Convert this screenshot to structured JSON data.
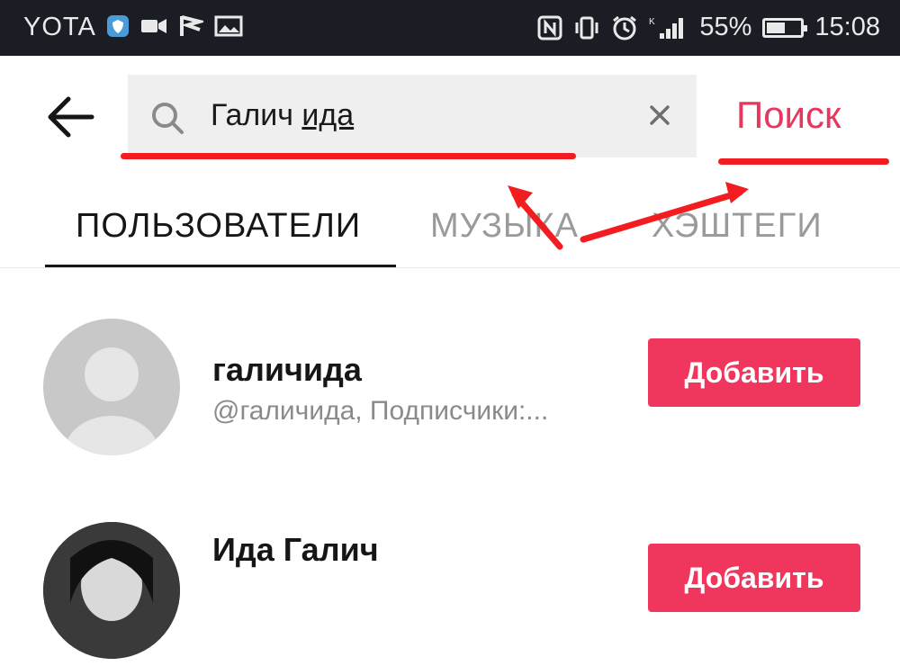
{
  "status_bar": {
    "carrier": "YOTA",
    "battery": "55%",
    "battery_level": 0.55,
    "time": "15:08"
  },
  "search": {
    "query_part1": "Галич ",
    "query_part2": "ида",
    "submit_label": "Поиск"
  },
  "tabs": [
    {
      "label": "ПОЛЬЗОВАТЕЛИ"
    },
    {
      "label": "МУЗЫКА"
    },
    {
      "label": "ХЭШТЕГИ"
    }
  ],
  "results": [
    {
      "name": "галичида",
      "subtitle": "@галичида, Подписчики:...",
      "button": "Добавить"
    },
    {
      "name": "Ида Галич",
      "subtitle": "",
      "button": "Добавить"
    }
  ],
  "colors": {
    "accent": "#f0365c",
    "annotation": "#f21d20",
    "status_bar_bg": "#1b1d24"
  }
}
